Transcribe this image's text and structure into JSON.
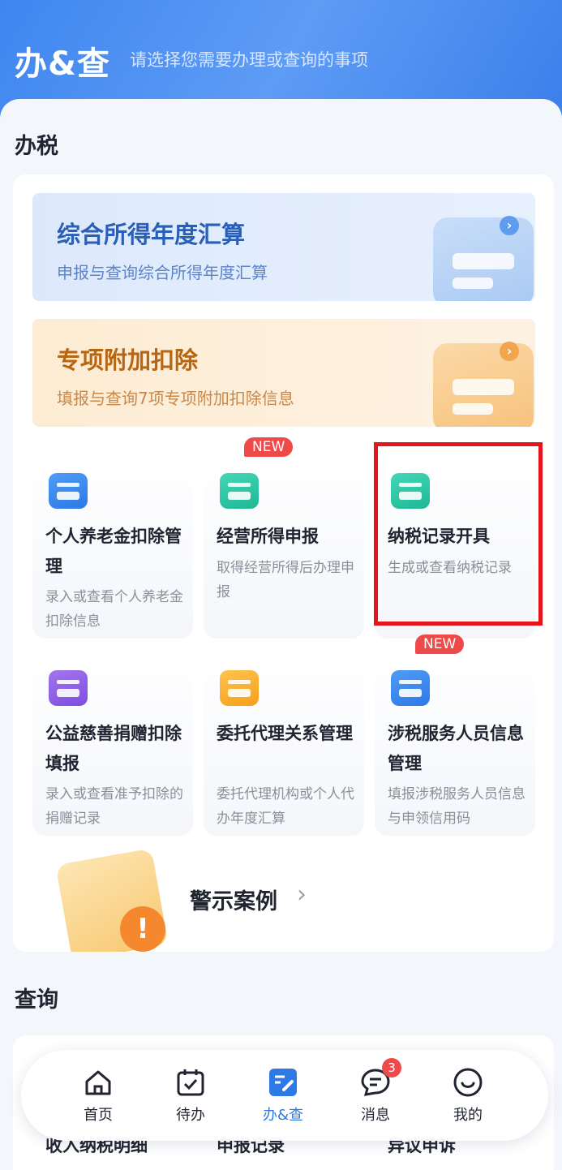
{
  "header": {
    "title": "办&查",
    "subtitle": "请选择您需要办理或查询的事项"
  },
  "tax_section": {
    "title": "办税",
    "banners": [
      {
        "title": "综合所得年度汇算",
        "subtitle": "申报与查询综合所得年度汇算",
        "arrow": "›"
      },
      {
        "title": "专项附加扣除",
        "subtitle": "填报与查询7项专项附加扣除信息",
        "arrow": "›"
      }
    ],
    "tiles": [
      {
        "title": "个人养老金扣除管理",
        "subtitle": "录入或查看个人养老金扣除信息",
        "new": ""
      },
      {
        "title": "经营所得申报",
        "subtitle": "取得经营所得后办理申报",
        "new": "NEW"
      },
      {
        "title": "纳税记录开具",
        "subtitle": "生成或查看纳税记录",
        "new": ""
      },
      {
        "title": "公益慈善捐赠扣除填报",
        "subtitle": "录入或查看准予扣除的捐赠记录",
        "new": ""
      },
      {
        "title": "委托代理关系管理",
        "subtitle": "委托代理机构或个人代办年度汇算",
        "new": ""
      },
      {
        "title": "涉税服务人员信息管理",
        "subtitle": "填报涉税服务人员信息与申领信用码",
        "new": "NEW"
      }
    ],
    "warning": {
      "label": "警示案例",
      "chevron": "›",
      "alert_glyph": "!"
    }
  },
  "query_section": {
    "title": "查询",
    "items": [
      "收入纳税明细",
      "申报记录",
      "异议申诉"
    ]
  },
  "nav": {
    "items": [
      {
        "label": "首页",
        "icon": "home-icon",
        "badge": ""
      },
      {
        "label": "待办",
        "icon": "calendar-check-icon",
        "badge": ""
      },
      {
        "label": "办&查",
        "icon": "handle-query-icon",
        "badge": ""
      },
      {
        "label": "消息",
        "icon": "message-icon",
        "badge": "3"
      },
      {
        "label": "我的",
        "icon": "smile-icon",
        "badge": ""
      }
    ],
    "active_index": 2
  },
  "colors": {
    "accent": "#2d79e6",
    "highlight": "#e8141b",
    "new_badge": "#ee4a4a"
  }
}
